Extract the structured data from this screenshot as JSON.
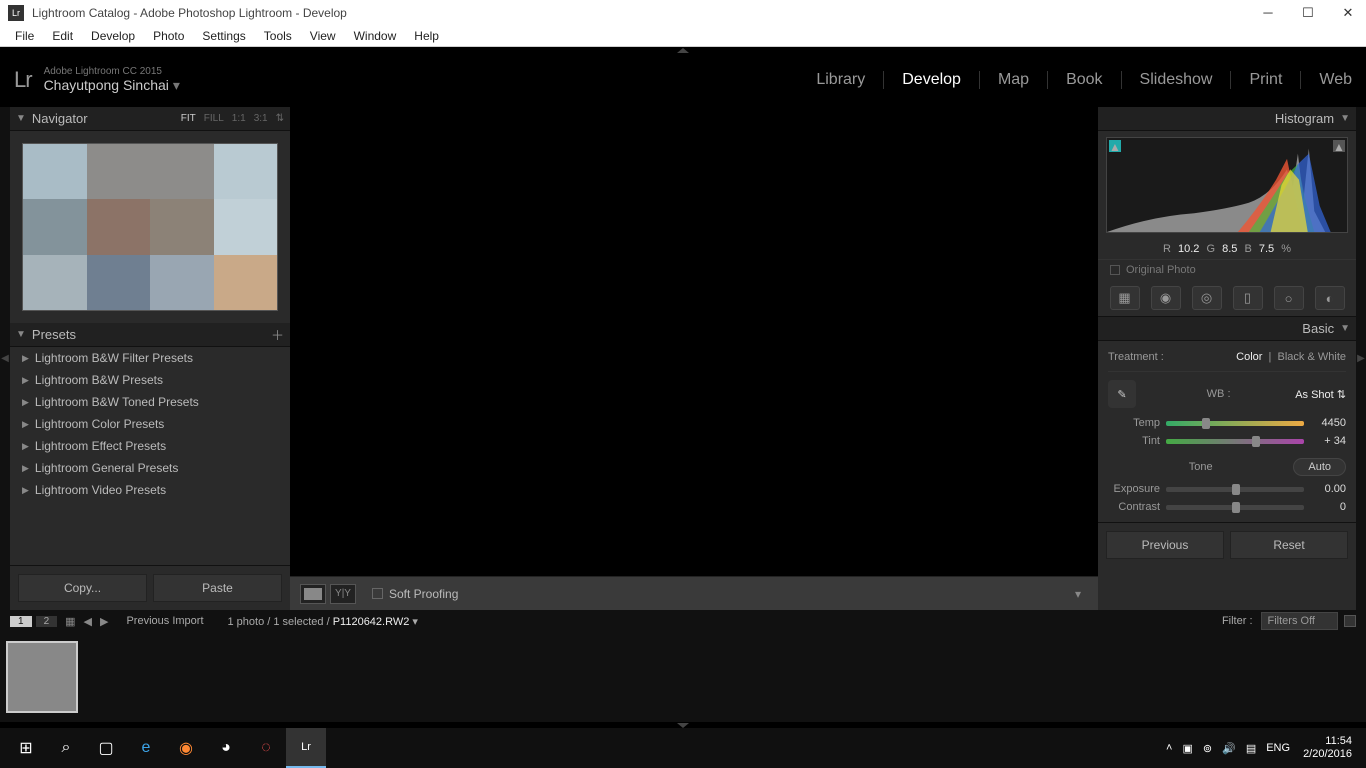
{
  "window": {
    "title": "Lightroom Catalog - Adobe Photoshop Lightroom - Develop",
    "icon_label": "Lr"
  },
  "menubar": [
    "File",
    "Edit",
    "Develop",
    "Photo",
    "Settings",
    "Tools",
    "View",
    "Window",
    "Help"
  ],
  "identity": {
    "logo": "Lr",
    "version": "Adobe Lightroom CC 2015",
    "user": "Chayutpong Sinchai"
  },
  "modules": [
    "Library",
    "Develop",
    "Map",
    "Book",
    "Slideshow",
    "Print",
    "Web"
  ],
  "active_module": "Develop",
  "navigator": {
    "title": "Navigator",
    "zoom_opts": [
      "FIT",
      "FILL",
      "1:1",
      "3:1"
    ],
    "zoom_active": "FIT"
  },
  "presets": {
    "title": "Presets",
    "items": [
      "Lightroom B&W Filter Presets",
      "Lightroom B&W Presets",
      "Lightroom B&W Toned Presets",
      "Lightroom Color Presets",
      "Lightroom Effect Presets",
      "Lightroom General Presets",
      "Lightroom Video Presets"
    ]
  },
  "left_buttons": {
    "copy": "Copy...",
    "paste": "Paste"
  },
  "center_toolbar": {
    "soft_proof": "Soft Proofing"
  },
  "histogram": {
    "title": "Histogram",
    "r_lbl": "R",
    "r": "10.2",
    "g_lbl": "G",
    "g": "8.5",
    "b_lbl": "B",
    "b": "7.5",
    "pct": "%",
    "original": "Original Photo"
  },
  "basic": {
    "title": "Basic",
    "treatment_lbl": "Treatment :",
    "color": "Color",
    "bw": "Black & White",
    "wb_lbl": "WB :",
    "wb_val": "As Shot",
    "temp_lbl": "Temp",
    "temp_val": "4450",
    "tint_lbl": "Tint",
    "tint_val": "+ 34",
    "tone_lbl": "Tone",
    "auto": "Auto",
    "exposure_lbl": "Exposure",
    "exposure_val": "0.00",
    "contrast_lbl": "Contrast",
    "contrast_val": "0"
  },
  "right_buttons": {
    "previous": "Previous",
    "reset": "Reset"
  },
  "filmstrip": {
    "prev_import": "Previous Import",
    "count": "1 photo / 1 selected /",
    "file": "P1120642.RW2",
    "filter_lbl": "Filter :",
    "filter_val": "Filters Off"
  },
  "taskbar": {
    "lang": "ENG",
    "time": "11:54",
    "date": "2/20/2016"
  },
  "nav_colors": [
    "#a9bcc6",
    "#8d8c8a",
    "#8d8c8a",
    "#b9cad2",
    "#83939b",
    "#8c7367",
    "#8c8277",
    "#c1d0d7",
    "#a6b3ba",
    "#6f7f91",
    "#99a6b2",
    "#c9a988"
  ]
}
